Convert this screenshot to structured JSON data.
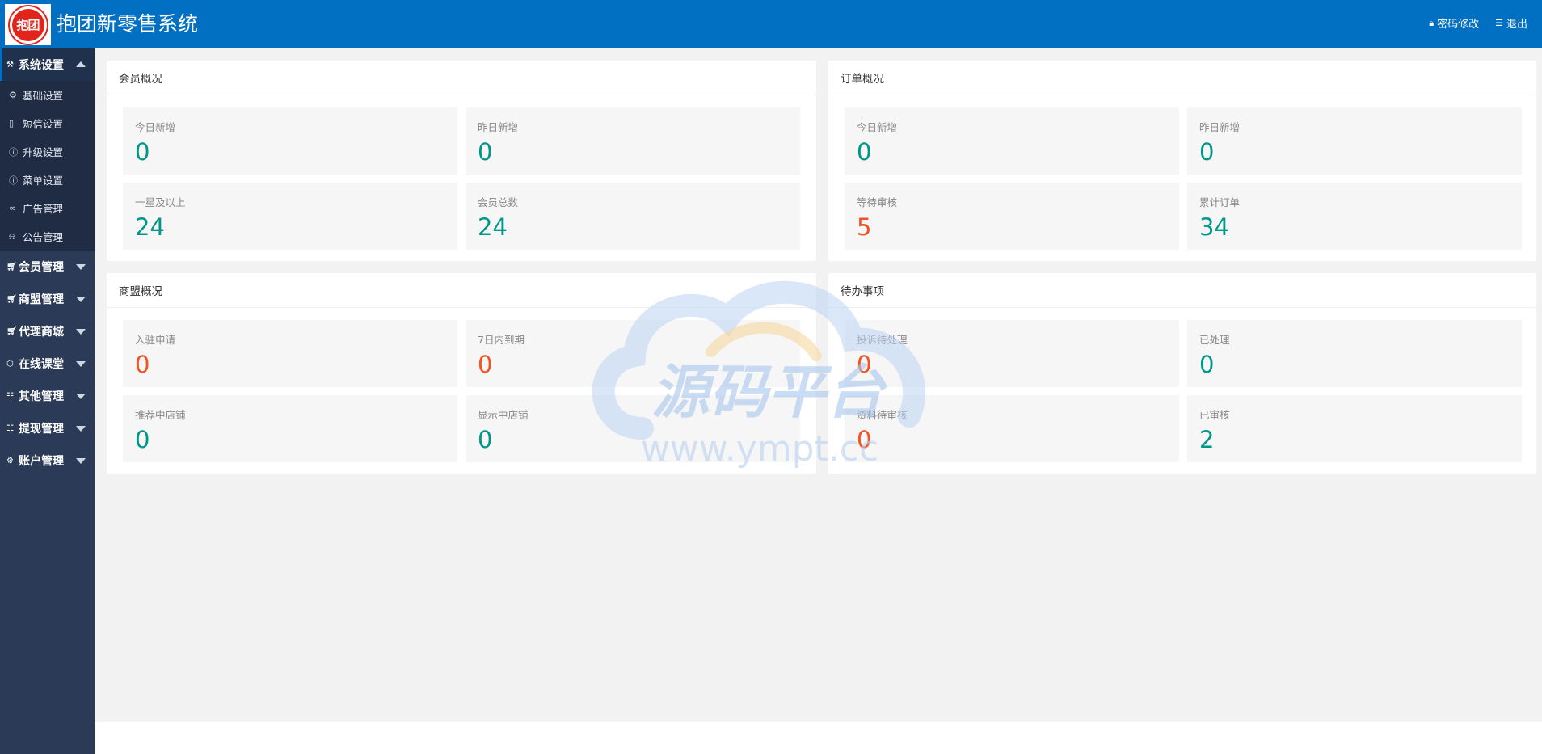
{
  "header": {
    "logo_text": "抱团",
    "title": "抱团新零售系统",
    "actions": [
      {
        "icon": "lock-icon",
        "label": "密码修改"
      },
      {
        "icon": "menu-icon",
        "label": "退出"
      }
    ]
  },
  "sidebar": {
    "groups": [
      {
        "icon": "tools-icon",
        "label": "系统设置",
        "expanded": true,
        "items": [
          {
            "icon": "gear-icon",
            "label": "基础设置"
          },
          {
            "icon": "phone-icon",
            "label": "短信设置"
          },
          {
            "icon": "upgrade-icon",
            "label": "升级设置"
          },
          {
            "icon": "upgrade-icon",
            "label": "菜单设置"
          },
          {
            "icon": "link-icon",
            "label": "广告管理"
          },
          {
            "icon": "bell-icon",
            "label": "公告管理"
          }
        ]
      },
      {
        "icon": "cart-icon",
        "label": "会员管理",
        "expanded": false
      },
      {
        "icon": "cart-icon",
        "label": "商盟管理",
        "expanded": false
      },
      {
        "icon": "cart-icon",
        "label": "代理商城",
        "expanded": false
      },
      {
        "icon": "cube-icon",
        "label": "在线课堂",
        "expanded": false
      },
      {
        "icon": "doc-icon",
        "label": "其他管理",
        "expanded": false
      },
      {
        "icon": "doc-icon",
        "label": "提现管理",
        "expanded": false
      },
      {
        "icon": "gear-icon",
        "label": "账户管理",
        "expanded": false
      }
    ]
  },
  "panels": [
    {
      "title": "会员概况",
      "stats": [
        {
          "label": "今日新增",
          "value": "0",
          "color": "#009688"
        },
        {
          "label": "昨日新增",
          "value": "0",
          "color": "#009688"
        },
        {
          "label": "一星及以上",
          "value": "24",
          "color": "#009688"
        },
        {
          "label": "会员总数",
          "value": "24",
          "color": "#009688"
        }
      ]
    },
    {
      "title": "订单概况",
      "stats": [
        {
          "label": "今日新增",
          "value": "0",
          "color": "#009688"
        },
        {
          "label": "昨日新增",
          "value": "0",
          "color": "#009688"
        },
        {
          "label": "等待审核",
          "value": "5",
          "color": "#f2531f"
        },
        {
          "label": "累计订单",
          "value": "34",
          "color": "#009688"
        }
      ]
    },
    {
      "title": "商盟概况",
      "stats": [
        {
          "label": "入驻申请",
          "value": "0",
          "color": "#f2531f"
        },
        {
          "label": "7日内到期",
          "value": "0",
          "color": "#f2531f"
        },
        {
          "label": "推荐中店铺",
          "value": "0",
          "color": "#009688"
        },
        {
          "label": "显示中店铺",
          "value": "0",
          "color": "#009688"
        }
      ]
    },
    {
      "title": "待办事项",
      "stats": [
        {
          "label": "投诉待处理",
          "value": "0",
          "color": "#f2531f"
        },
        {
          "label": "已处理",
          "value": "0",
          "color": "#009688"
        },
        {
          "label": "资料待审核",
          "value": "0",
          "color": "#f2531f"
        },
        {
          "label": "已审核",
          "value": "2",
          "color": "#009688"
        }
      ]
    }
  ],
  "watermark": {
    "title": "源码平台",
    "url": "www.ympt.cc"
  },
  "colors": {
    "header": "#0170c2",
    "sidebar": "#2b3b57",
    "green": "#009688",
    "red": "#f2531f"
  }
}
